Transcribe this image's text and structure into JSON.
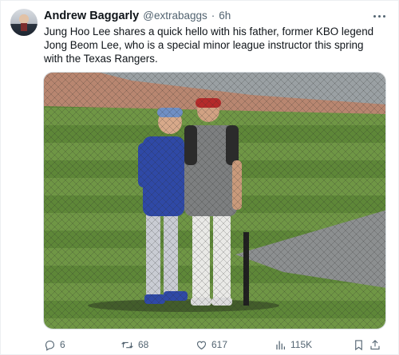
{
  "tweet": {
    "author_name": "Andrew Baggarly",
    "handle": "@extrabaggs",
    "separator": "·",
    "time": "6h",
    "text": "Jung Hoo Lee shares a quick hello with his father, former KBO legend Jong Beom Lee, who is a special minor league instructor this spring with the Texas Rangers."
  },
  "icons": {
    "avatar": "profile-photo",
    "more": "more-horizontal-icon",
    "reply": "reply-icon",
    "retweet": "retweet-icon",
    "like": "heart-icon",
    "views": "views-bar-chart-icon",
    "bookmark": "bookmark-icon",
    "share": "share-icon"
  },
  "actions": {
    "replies": "6",
    "retweets": "68",
    "likes": "617",
    "views": "115K"
  },
  "colors": {
    "text_primary": "#0f1419",
    "text_secondary": "#536471",
    "border": "#eceff1"
  }
}
